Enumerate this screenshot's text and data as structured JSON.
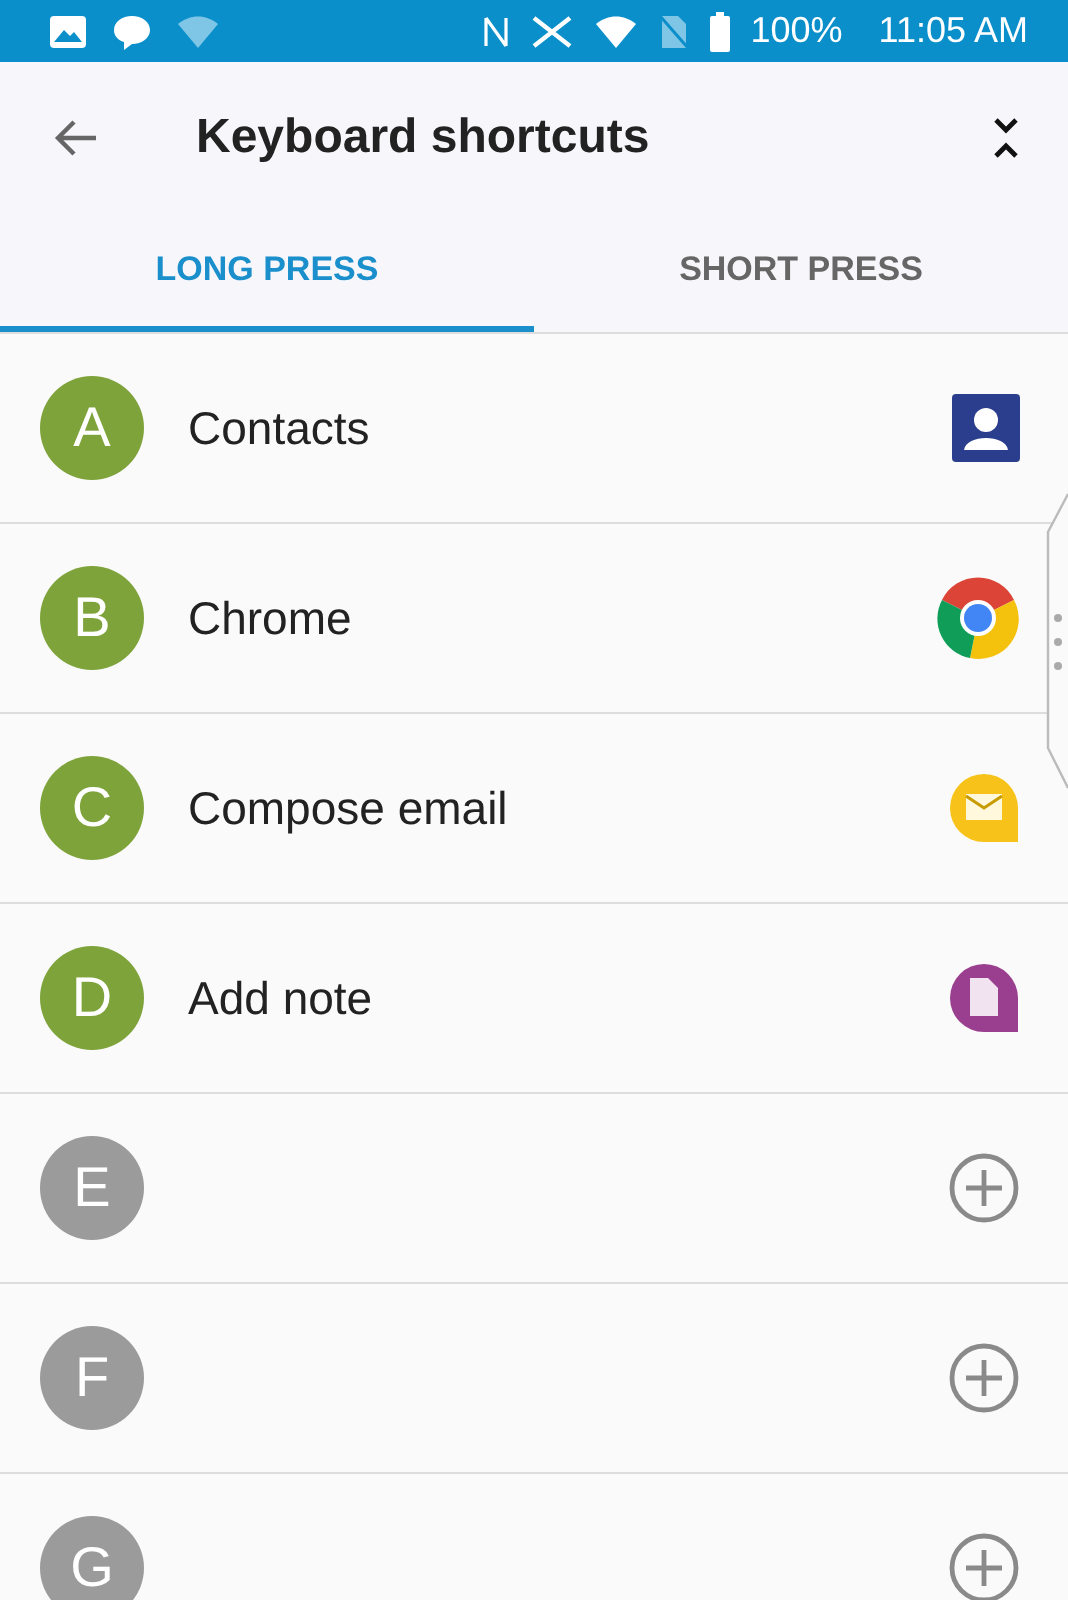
{
  "status_bar": {
    "battery": "100%",
    "time": "11:05 AM"
  },
  "header": {
    "title": "Keyboard shortcuts"
  },
  "tabs": [
    {
      "label": "LONG PRESS",
      "selected": true
    },
    {
      "label": "SHORT PRESS",
      "selected": false
    }
  ],
  "shortcuts": [
    {
      "letter": "A",
      "kind": "contacts",
      "label": "Contacts"
    },
    {
      "letter": "B",
      "kind": "chrome",
      "label": "Chrome"
    },
    {
      "letter": "C",
      "kind": "email",
      "label": "Compose email"
    },
    {
      "letter": "D",
      "kind": "note",
      "label": "Add note"
    },
    {
      "letter": "E",
      "kind": "empty"
    },
    {
      "letter": "F",
      "kind": "empty"
    },
    {
      "letter": "G",
      "kind": "empty"
    }
  ]
}
